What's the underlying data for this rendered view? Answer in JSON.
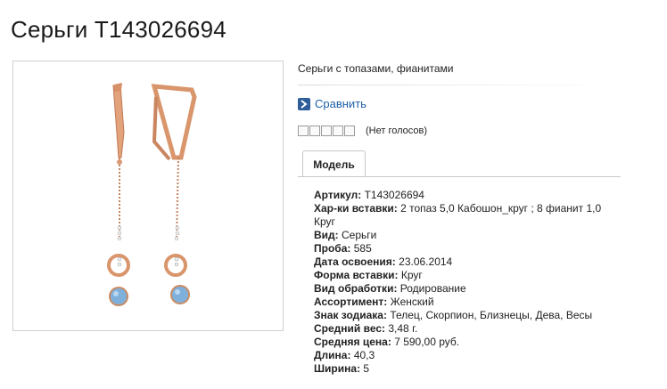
{
  "product": {
    "title": "Серьги Т143026694",
    "description": "Серьги с топазами, фианитами"
  },
  "compare": {
    "label": "Сравнить",
    "icon": "arrow-right-icon"
  },
  "rating": {
    "stars_total": 5,
    "stars_filled": 0,
    "votes_text": "(Нет голосов)"
  },
  "tabs": [
    {
      "label": "Модель",
      "active": true
    }
  ],
  "properties": [
    {
      "label": "Артикул:",
      "value": "Т143026694"
    },
    {
      "label": "Хар-ки вставки:",
      "value": "2 топаз 5,0 Кабошон_круг ; 8 фианит 1,0 Круг"
    },
    {
      "label": "Вид:",
      "value": "Серьги"
    },
    {
      "label": "Проба:",
      "value": "585"
    },
    {
      "label": "Дата освоения:",
      "value": "23.06.2014"
    },
    {
      "label": "Форма вставки:",
      "value": "Круг"
    },
    {
      "label": "Вид обработки:",
      "value": "Родирование"
    },
    {
      "label": "Ассортимент:",
      "value": "Женский"
    },
    {
      "label": "Знак зодиака:",
      "value": "Телец, Скорпион, Близнецы, Дева, Весы"
    },
    {
      "label": "Средний вес:",
      "value": "3,48 г."
    },
    {
      "label": "Средняя цена:",
      "value": "7 590,00 руб."
    },
    {
      "label": "Длина:",
      "value": "40,3"
    },
    {
      "label": "Ширина:",
      "value": "5"
    }
  ],
  "colors": {
    "link": "#1f5fa8",
    "compare_icon": "#2f5d9a",
    "gold": "#d9956b",
    "topaz": "#7fb0dc"
  }
}
